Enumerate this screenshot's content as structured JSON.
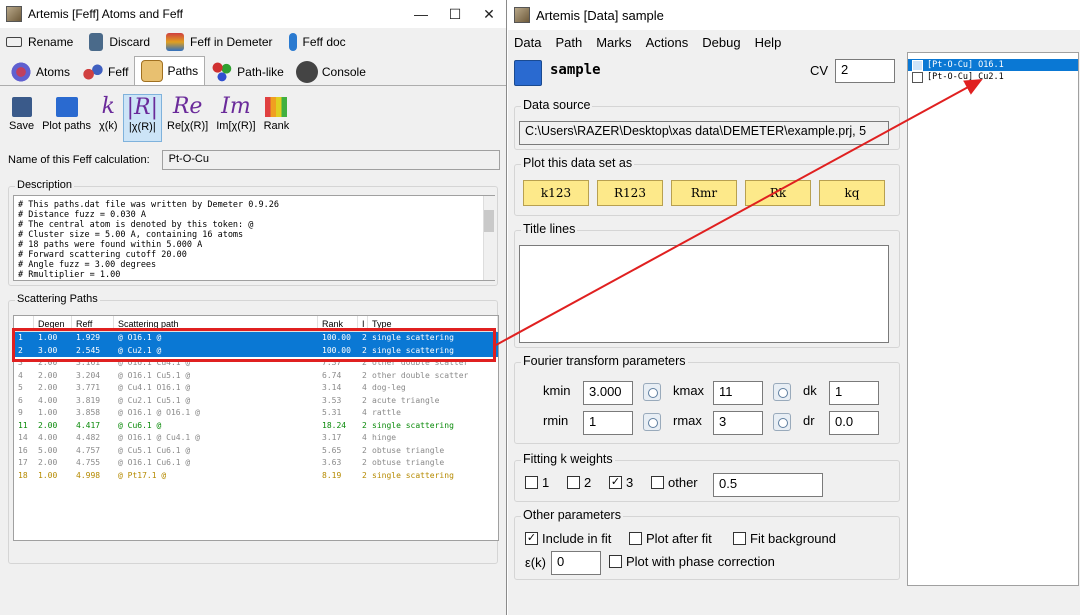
{
  "feff_window": {
    "title": "Artemis [Feff] Atoms and Feff",
    "toolbar": [
      "Rename",
      "Discard",
      "Feff in Demeter",
      "Feff doc"
    ],
    "tabs": [
      "Atoms",
      "Feff",
      "Paths",
      "Path-like",
      "Console"
    ],
    "plot_buttons": [
      {
        "glyph": "",
        "label": "Save"
      },
      {
        "glyph": "",
        "label": "Plot paths"
      },
      {
        "glyph": "k",
        "label": "χ(k)"
      },
      {
        "glyph": "|R|",
        "label": "|χ(R)|"
      },
      {
        "glyph": "Re",
        "label": "Re[χ(R)]"
      },
      {
        "glyph": "Im",
        "label": "Im[χ(R)]"
      },
      {
        "glyph": "",
        "label": "Rank"
      }
    ],
    "name_label": "Name of this Feff calculation:",
    "name_value": "Pt-O-Cu",
    "description_label": "Description",
    "description_text": "# This paths.dat file was written by Demeter 0.9.26\n# Distance fuzz = 0.030 A\n# The central atom is denoted by this token: @\n# Cluster size = 5.00 A, containing 16 atoms\n# 18 paths were found within 5.000 A\n# Forward scattering cutoff 20.00\n# Angle fuzz = 3.00 degrees\n# Rmultiplier = 1.00",
    "scattering_label": "Scattering Paths",
    "columns": [
      "",
      "Degen",
      "Reff",
      "Scattering path",
      "Rank",
      "I",
      "Type"
    ],
    "paths": [
      {
        "n": "1",
        "degen": "1.00",
        "reff": "1.929",
        "path": "@ O16.1  @",
        "rank": "100.00",
        "i": "2",
        "type": "single scattering",
        "style": "sel"
      },
      {
        "n": "2",
        "degen": "3.00",
        "reff": "2.545",
        "path": "@ Cu2.1  @",
        "rank": "100.00",
        "i": "2",
        "type": "single scattering",
        "style": "sel"
      },
      {
        "n": "3",
        "degen": "2.00",
        "reff": "3.161",
        "path": "@ O16.1  Cu4.1  @",
        "rank": "7.37",
        "i": "2",
        "type": "other double scatter",
        "style": "gray"
      },
      {
        "n": "4",
        "degen": "2.00",
        "reff": "3.204",
        "path": "@ O16.1  Cu5.1  @",
        "rank": "6.74",
        "i": "2",
        "type": "other double scatter",
        "style": "gray"
      },
      {
        "n": "5",
        "degen": "2.00",
        "reff": "3.771",
        "path": "@ Cu4.1  O16.1  @",
        "rank": "3.14",
        "i": "4",
        "type": "dog-leg",
        "style": "gray"
      },
      {
        "n": "6",
        "degen": "4.00",
        "reff": "3.819",
        "path": "@ Cu2.1  Cu5.1  @",
        "rank": "3.53",
        "i": "2",
        "type": "acute triangle",
        "style": "gray"
      },
      {
        "n": "9",
        "degen": "1.00",
        "reff": "3.858",
        "path": "@ O16.1  @      O16.1  @",
        "rank": "5.31",
        "i": "4",
        "type": "rattle",
        "style": "gray"
      },
      {
        "n": "11",
        "degen": "2.00",
        "reff": "4.417",
        "path": "@ Cu6.1  @",
        "rank": "18.24",
        "i": "2",
        "type": "single scattering",
        "style": "green"
      },
      {
        "n": "14",
        "degen": "4.00",
        "reff": "4.482",
        "path": "@ O16.1  @      Cu4.1  @",
        "rank": "3.17",
        "i": "4",
        "type": "hinge",
        "style": "gray"
      },
      {
        "n": "16",
        "degen": "5.00",
        "reff": "4.757",
        "path": "@ Cu5.1  Cu6.1  @",
        "rank": "5.65",
        "i": "2",
        "type": "obtuse triangle",
        "style": "gray"
      },
      {
        "n": "17",
        "degen": "2.00",
        "reff": "4.755",
        "path": "@ O16.1  Cu6.1  @",
        "rank": "3.63",
        "i": "2",
        "type": "obtuse triangle",
        "style": "gray"
      },
      {
        "n": "18",
        "degen": "1.00",
        "reff": "4.998",
        "path": "@ Pt17.1  @",
        "rank": "8.19",
        "i": "2",
        "type": "single scattering",
        "style": "gold"
      }
    ]
  },
  "data_window": {
    "title": "Artemis [Data] sample",
    "menu": [
      "Data",
      "Path",
      "Marks",
      "Actions",
      "Debug",
      "Help"
    ],
    "name": "sample",
    "cv_label": "CV",
    "cv_value": "2",
    "data_source_label": "Data source",
    "data_source_value": "C:\\Users\\RAZER\\Desktop\\xas data\\DEMETER\\example.prj, 5",
    "plot_label": "Plot this data set as",
    "plot_buttons": [
      "k123",
      "R123",
      "Rmr",
      "Rk",
      "kq"
    ],
    "title_lines_label": "Title lines",
    "fourier_label": "Fourier transform parameters",
    "kmin_label": "kmin",
    "kmin": "3.000",
    "kmax_label": "kmax",
    "kmax": "11",
    "dk_label": "dk",
    "dk": "1",
    "rmin_label": "rmin",
    "rmin": "1",
    "rmax_label": "rmax",
    "rmax": "3",
    "dr_label": "dr",
    "dr": "0.0",
    "kweights_label": "Fitting k weights",
    "kw": [
      {
        "label": "1",
        "checked": false
      },
      {
        "label": "2",
        "checked": false
      },
      {
        "label": "3",
        "checked": true
      },
      {
        "label": "other",
        "checked": false
      }
    ],
    "kw_other": "0.5",
    "other_label": "Other parameters",
    "include_in_fit": "Include in fit",
    "plot_after_fit": "Plot after fit",
    "fit_background": "Fit background",
    "epsilon_label": "ε(k)",
    "epsilon_value": "0",
    "phase_corr": "Plot with phase correction",
    "path_list": [
      "[Pt-O-Cu] O16.1",
      "[Pt-O-Cu] Cu2.1"
    ]
  },
  "colors": {
    "selection": "#0a78d4",
    "highlight": "#e02020",
    "plot_button": "#fde98a"
  }
}
